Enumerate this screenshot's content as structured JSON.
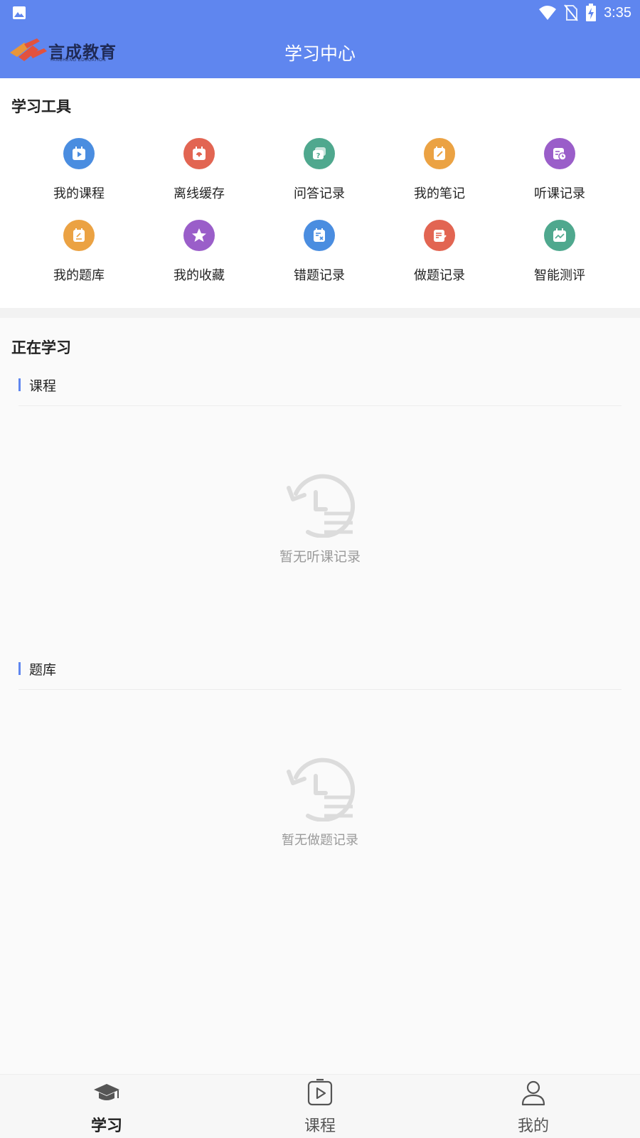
{
  "status_bar": {
    "time": "3:35"
  },
  "header": {
    "logo_text": "言成教育",
    "logo_subtext": "YANCHENG EDUCATION",
    "title": "学习中心",
    "background_color": "#5f86ef"
  },
  "tools": {
    "title": "学习工具",
    "items": [
      {
        "label": "我的课程",
        "icon": "play-icon",
        "color": "#4a8de0"
      },
      {
        "label": "离线缓存",
        "icon": "download-icon",
        "color": "#e26552"
      },
      {
        "label": "问答记录",
        "icon": "question-icon",
        "color": "#4fa88e"
      },
      {
        "label": "我的笔记",
        "icon": "note-icon",
        "color": "#eba243"
      },
      {
        "label": "听课记录",
        "icon": "history-icon",
        "color": "#9a5ec9"
      },
      {
        "label": "我的题库",
        "icon": "question-bank-icon",
        "color": "#eba243"
      },
      {
        "label": "我的收藏",
        "icon": "star-icon",
        "color": "#9a5ec9"
      },
      {
        "label": "错题记录",
        "icon": "wrong-question-icon",
        "color": "#4a8de0"
      },
      {
        "label": "做题记录",
        "icon": "exercise-record-icon",
        "color": "#e26552"
      },
      {
        "label": "智能测评",
        "icon": "chart-icon",
        "color": "#4fa88e"
      }
    ]
  },
  "learning": {
    "title": "正在学习",
    "course_heading": "课程",
    "course_empty": "暂无听课记录",
    "bank_heading": "题库",
    "bank_empty": "暂无做题记录"
  },
  "bottom_nav": {
    "items": [
      {
        "label": "学习",
        "icon": "graduation-cap-icon",
        "active": true
      },
      {
        "label": "课程",
        "icon": "video-icon",
        "active": false
      },
      {
        "label": "我的",
        "icon": "user-icon",
        "active": false
      }
    ],
    "active_color": "#222222",
    "inactive_color": "#555555"
  }
}
